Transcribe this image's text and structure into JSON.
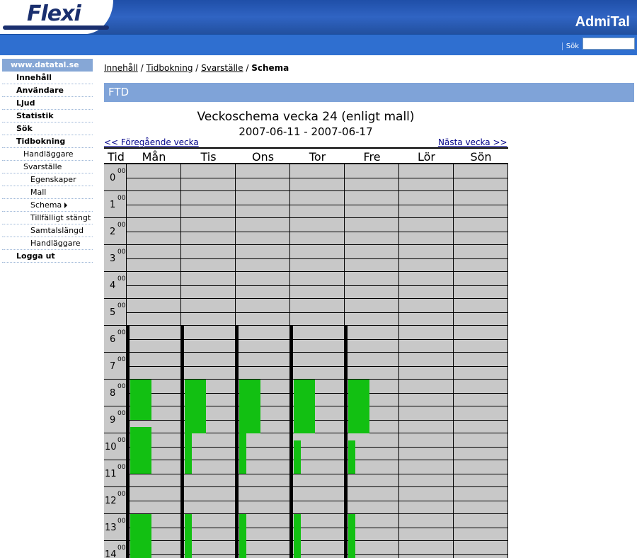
{
  "header": {
    "logo_text": "Flexi",
    "brand": "AdmiTal",
    "search_label": "Sök",
    "search_value": ""
  },
  "sidebar": {
    "site": "www.datatal.se",
    "items": [
      {
        "label": "Innehåll",
        "level": 0
      },
      {
        "label": "Användare",
        "level": 0
      },
      {
        "label": "Ljud",
        "level": 0
      },
      {
        "label": "Statistik",
        "level": 0
      },
      {
        "label": "Sök",
        "level": 0
      },
      {
        "label": "Tidbokning",
        "level": 0
      },
      {
        "label": "Handläggare",
        "level": 1
      },
      {
        "label": "Svarställe",
        "level": 1
      },
      {
        "label": "Egenskaper",
        "level": 2
      },
      {
        "label": "Mall",
        "level": 2
      },
      {
        "label": "Schema",
        "level": 2,
        "active": true,
        "icon": "triangle-right-icon"
      },
      {
        "label": "Tillfälligt stängt",
        "level": 2
      },
      {
        "label": "Samtalslängd",
        "level": 2
      },
      {
        "label": "Handläggare",
        "level": 2
      },
      {
        "label": "Logga ut",
        "level": 0
      }
    ]
  },
  "breadcrumb": {
    "items": [
      "Innehåll",
      "Tidbokning",
      "Svarställe"
    ],
    "separator": "/",
    "current": "Schema"
  },
  "section": {
    "title": "FTD"
  },
  "schedule": {
    "title": "Veckoschema vecka 24 (enligt mall)",
    "dates": "2007-06-11 - 2007-06-17",
    "prev_link": "<< Föregående vecka",
    "next_link": "Nästa vecka >>",
    "time_header": "Tid",
    "days": [
      "Mån",
      "Tis",
      "Ons",
      "Tor",
      "Fre",
      "Lör",
      "Sön"
    ],
    "hours": [
      "0",
      "1",
      "2",
      "3",
      "4",
      "5",
      "6",
      "7",
      "8",
      "9",
      "10",
      "11",
      "12",
      "13",
      "14"
    ],
    "minute_label": "00",
    "open_from_hour": 6,
    "open_days": [
      0,
      1,
      2,
      3,
      4
    ],
    "colors": {
      "booked": "#12c012",
      "background": "#c8c8c8",
      "header": "#7fa3d8"
    },
    "booked_blocks": [
      {
        "day": 0,
        "sub": 0,
        "start": 8.0,
        "end": 9.5
      },
      {
        "day": 0,
        "sub": 0,
        "start": 9.75,
        "end": 11.5
      },
      {
        "day": 0,
        "sub": 0,
        "start": 13.0,
        "end": 15.0
      },
      {
        "day": 1,
        "sub": 0,
        "start": 8.0,
        "end": 10.0
      },
      {
        "day": 1,
        "sub": 1,
        "start": 10.0,
        "end": 11.5
      },
      {
        "day": 1,
        "sub": 1,
        "start": 13.0,
        "end": 15.0
      },
      {
        "day": 2,
        "sub": 0,
        "start": 8.0,
        "end": 10.0
      },
      {
        "day": 2,
        "sub": 1,
        "start": 10.0,
        "end": 11.5
      },
      {
        "day": 2,
        "sub": 1,
        "start": 13.0,
        "end": 15.0
      },
      {
        "day": 3,
        "sub": 0,
        "start": 8.0,
        "end": 10.0
      },
      {
        "day": 3,
        "sub": 1,
        "start": 10.25,
        "end": 11.5
      },
      {
        "day": 3,
        "sub": 1,
        "start": 13.0,
        "end": 15.0
      },
      {
        "day": 4,
        "sub": 0,
        "start": 8.0,
        "end": 10.0
      },
      {
        "day": 4,
        "sub": 1,
        "start": 10.25,
        "end": 11.5
      },
      {
        "day": 4,
        "sub": 1,
        "start": 13.0,
        "end": 15.0
      }
    ]
  }
}
